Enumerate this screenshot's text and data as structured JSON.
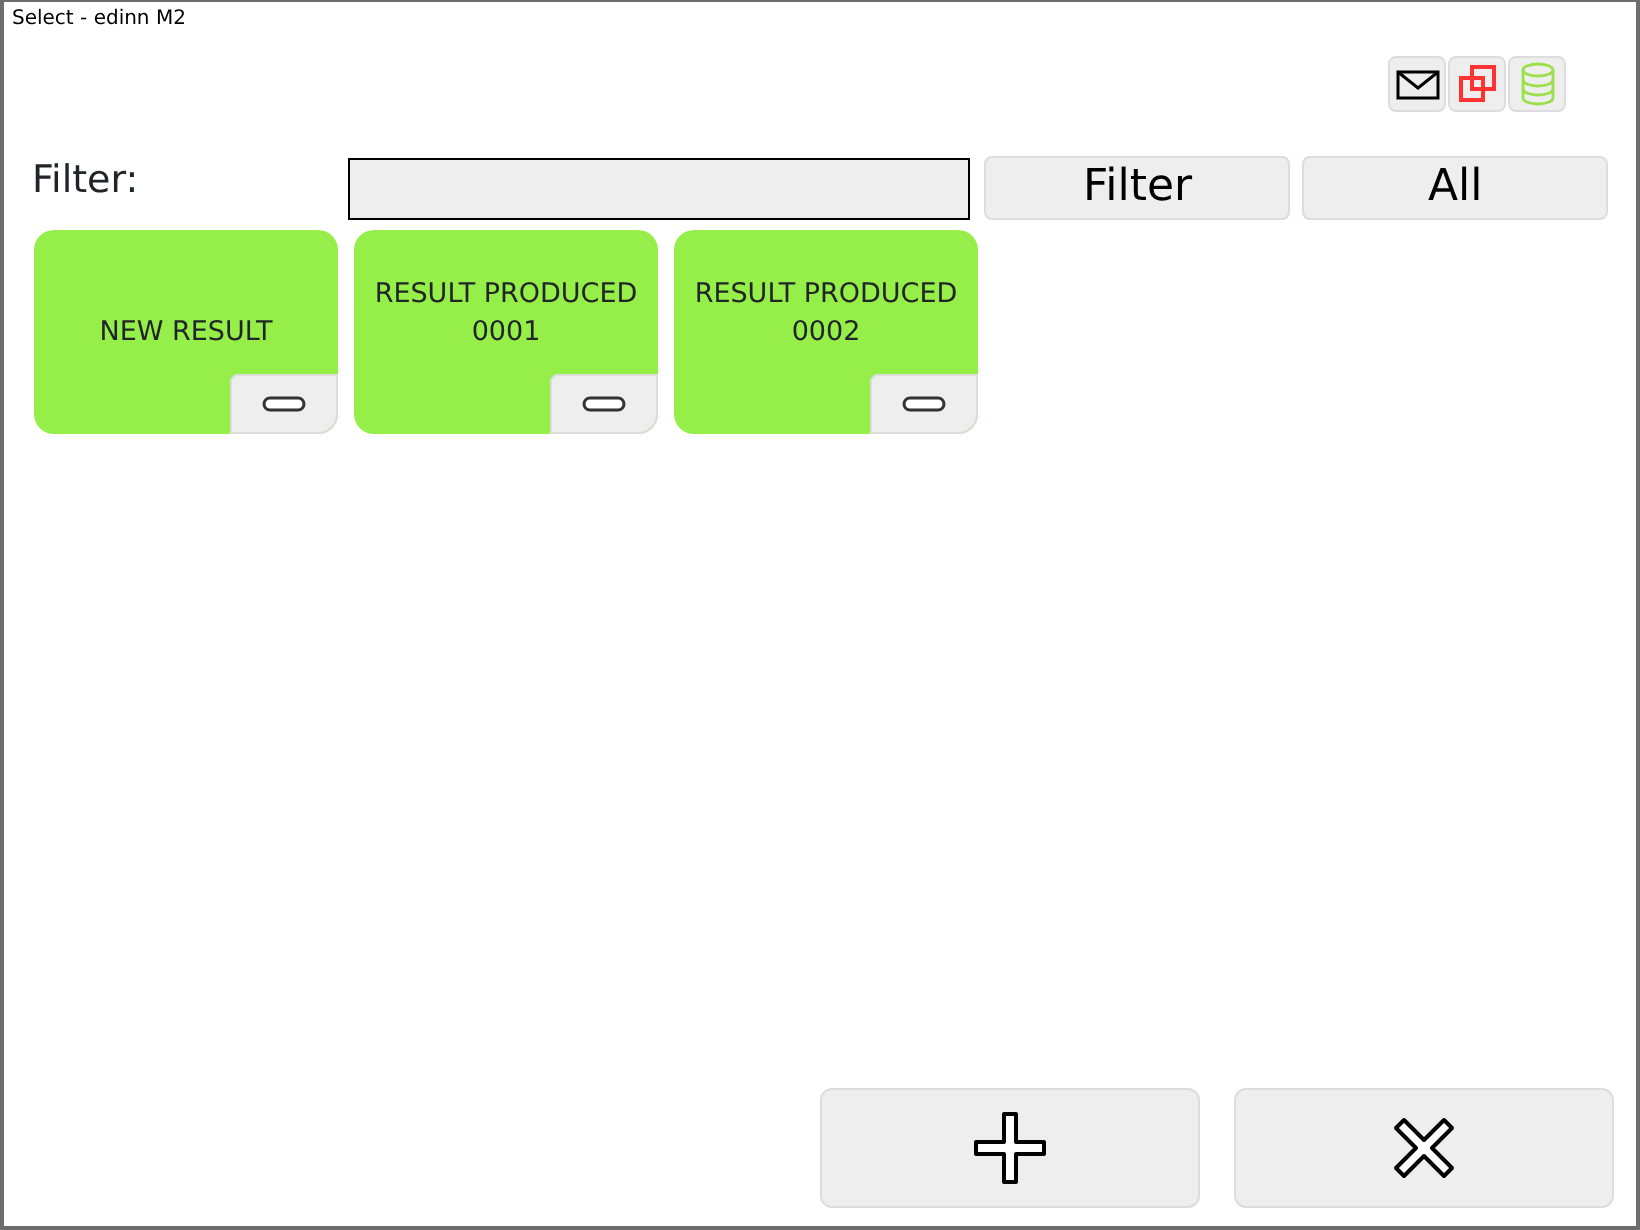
{
  "window": {
    "title": "Select - edinn M2"
  },
  "filter": {
    "label": "Filter:",
    "filter_button": "Filter",
    "all_button": "All"
  },
  "results": [
    {
      "label": "NEW RESULT"
    },
    {
      "label": "RESULT PRODUCED 0001"
    },
    {
      "label": "RESULT PRODUCED 0002"
    }
  ]
}
